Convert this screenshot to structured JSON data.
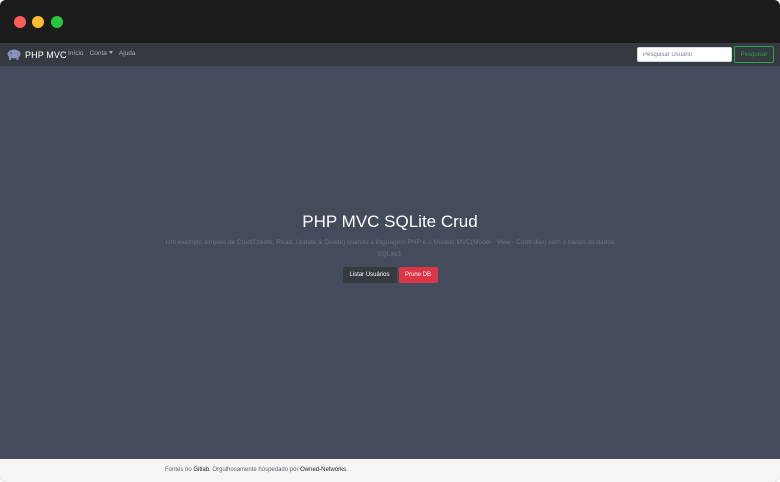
{
  "navbar": {
    "brand": "PHP MVC",
    "links": [
      "Início",
      "Conta",
      "Ajuda"
    ],
    "search_placeholder": "Pesquisar Usuário",
    "search_button": "Pesquisar"
  },
  "hero": {
    "title": "PHP MVC SQLite Crud",
    "description": "Um exemplo simples de Crud(Create, Read, Update & Delete) usando a linguagem PHP e o Modelo MVC(Model - View - Controller) com o banco de dados SQLite3.",
    "buttons": {
      "list_users": "Listar Usuários",
      "prune_db": "Prune DB"
    }
  },
  "footer": {
    "prefix": "Fontes no ",
    "gitlab": "Gitlab",
    "middle": ". Orgulhosamente hospedado por ",
    "host": "Owned-Networks",
    "suffix": "."
  },
  "colors": {
    "hero_bg": "#444c5c",
    "navbar_bg": "#343a40",
    "success": "#28a745",
    "danger": "#dc3545"
  }
}
